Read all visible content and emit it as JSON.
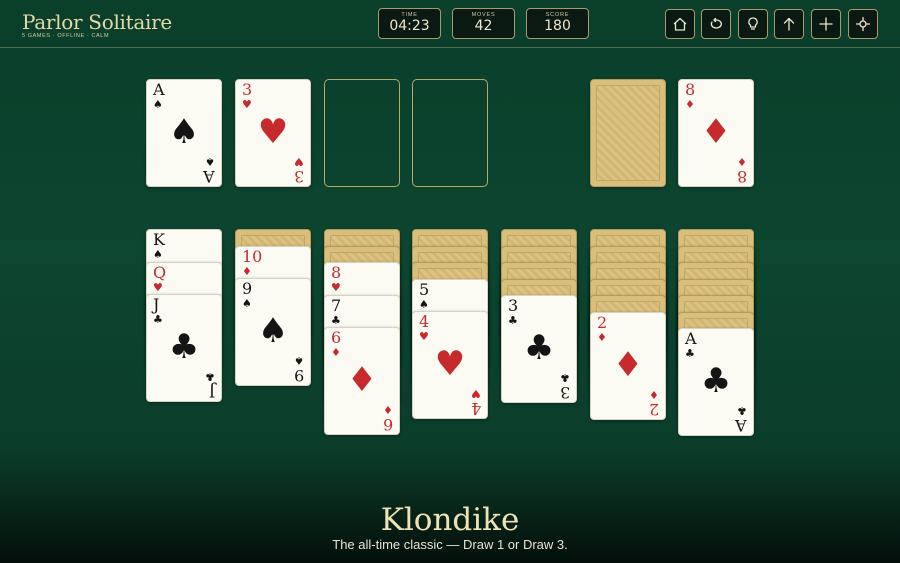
{
  "app": {
    "title": "Parlor Solitaire",
    "tagline": "5 GAMES · OFFLINE · CALM"
  },
  "stats": {
    "time": {
      "label": "TIME",
      "value": "04:23"
    },
    "moves": {
      "label": "MOVES",
      "value": "42"
    },
    "score": {
      "label": "SCORE",
      "value": "180"
    }
  },
  "toolbar": [
    "home-icon",
    "undo-icon",
    "hint-bulb-icon",
    "auto-up-arrow-icon",
    "new-game-plus-icon",
    "settings-crosshair-icon"
  ],
  "colors": {
    "felt": "#0c4530",
    "card_back": "#d9bf7c",
    "red_suit": "#c62a2d",
    "gold": "#e6d8a8"
  },
  "foundations": [
    {
      "rank": "A",
      "suit": "♠",
      "color": "blk"
    },
    {
      "rank": "3",
      "suit": "♥",
      "color": "red"
    },
    null,
    null
  ],
  "stock": {
    "face_down": true
  },
  "waste": {
    "rank": "8",
    "suit": "♦",
    "color": "red"
  },
  "tableau": [
    {
      "down": 0,
      "up": [
        {
          "rank": "K",
          "suit": "♠",
          "color": "blk"
        },
        {
          "rank": "Q",
          "suit": "♥",
          "color": "red"
        },
        {
          "rank": "J",
          "suit": "♣",
          "color": "blk"
        }
      ]
    },
    {
      "down": 1,
      "up": [
        {
          "rank": "10",
          "suit": "♦",
          "color": "red"
        },
        {
          "rank": "9",
          "suit": "♠",
          "color": "blk"
        }
      ]
    },
    {
      "down": 2,
      "up": [
        {
          "rank": "8",
          "suit": "♥",
          "color": "red"
        },
        {
          "rank": "7",
          "suit": "♣",
          "color": "blk"
        },
        {
          "rank": "6",
          "suit": "♦",
          "color": "red"
        }
      ]
    },
    {
      "down": 3,
      "up": [
        {
          "rank": "5",
          "suit": "♠",
          "color": "blk"
        },
        {
          "rank": "4",
          "suit": "♥",
          "color": "red"
        }
      ]
    },
    {
      "down": 4,
      "up": [
        {
          "rank": "3",
          "suit": "♣",
          "color": "blk"
        }
      ]
    },
    {
      "down": 5,
      "up": [
        {
          "rank": "2",
          "suit": "♦",
          "color": "red"
        }
      ]
    },
    {
      "down": 6,
      "up": [
        {
          "rank": "A",
          "suit": "♣",
          "color": "blk"
        }
      ]
    }
  ],
  "game": {
    "name": "Klondike",
    "description": "The all-time classic — Draw 1 or Draw 3."
  }
}
